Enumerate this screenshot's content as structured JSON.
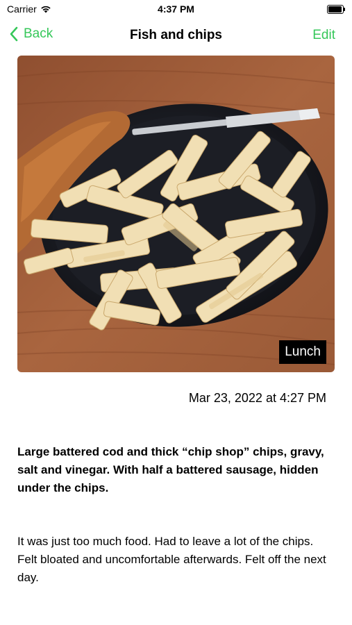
{
  "status_bar": {
    "carrier": "Carrier",
    "time": "4:37 PM"
  },
  "nav": {
    "back_label": "Back",
    "title": "Fish and chips",
    "edit_label": "Edit"
  },
  "meal": {
    "category_badge": "Lunch",
    "date": "Mar 23, 2022 at 4:27 PM",
    "description": "Large battered cod and thick “chip shop” chips, gravy, salt and vinegar. With half a battered sausage, hidden under the chips.",
    "notes": "It was just too much food. Had to leave a lot of the chips. Felt bloated and uncomfortable afterwards. Felt off the next day."
  },
  "colors": {
    "accent": "#35c759",
    "table_wood": "#9a5a37",
    "plate": "#1a1c22",
    "chips": "#f1dfb4",
    "batter": "#b36a34"
  }
}
